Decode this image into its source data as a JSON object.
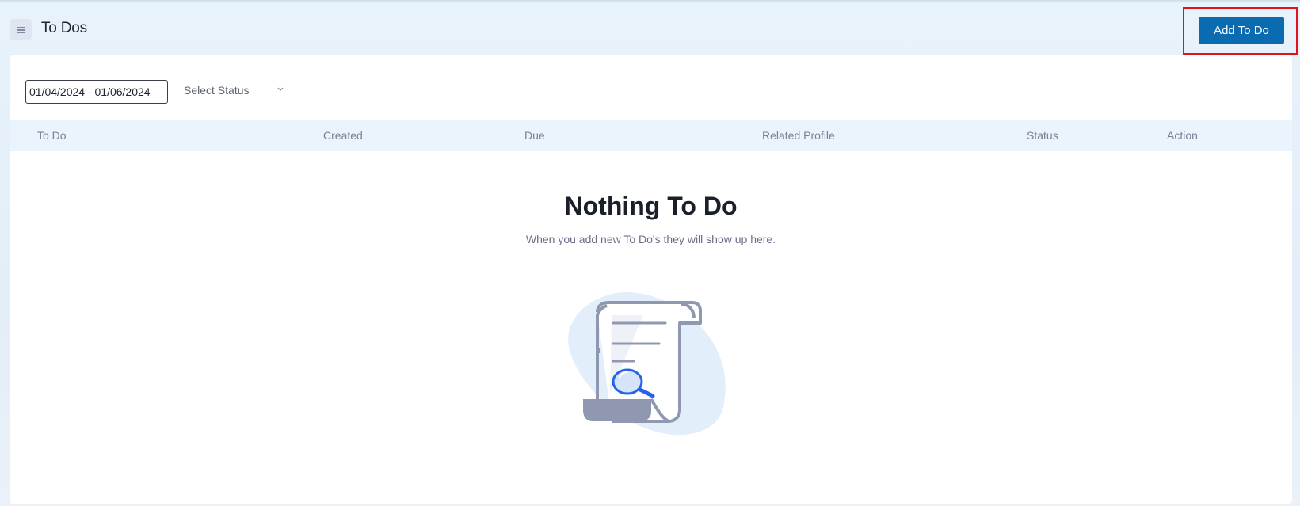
{
  "header": {
    "title": "To Dos",
    "add_button_label": "Add To Do",
    "menu_icon": "hamburger-menu-icon"
  },
  "filters": {
    "date_range_value": "01/04/2024 - 01/06/2024",
    "status_placeholder": "Select Status",
    "status_icon": "chevron-down-icon"
  },
  "table": {
    "columns": [
      "To Do",
      "Created",
      "Due",
      "Related Profile",
      "Status",
      "Action"
    ]
  },
  "empty_state": {
    "title": "Nothing To Do",
    "subtitle": "When you add new To Do's they will show up here.",
    "illustration_icon": "document-search-icon"
  },
  "colors": {
    "primary": "#0a6bb0",
    "highlight": "#e0121b",
    "header_bg": "#eaf4fc",
    "illustration_gray": "#8f98b0",
    "illustration_blue": "#2563eb"
  }
}
